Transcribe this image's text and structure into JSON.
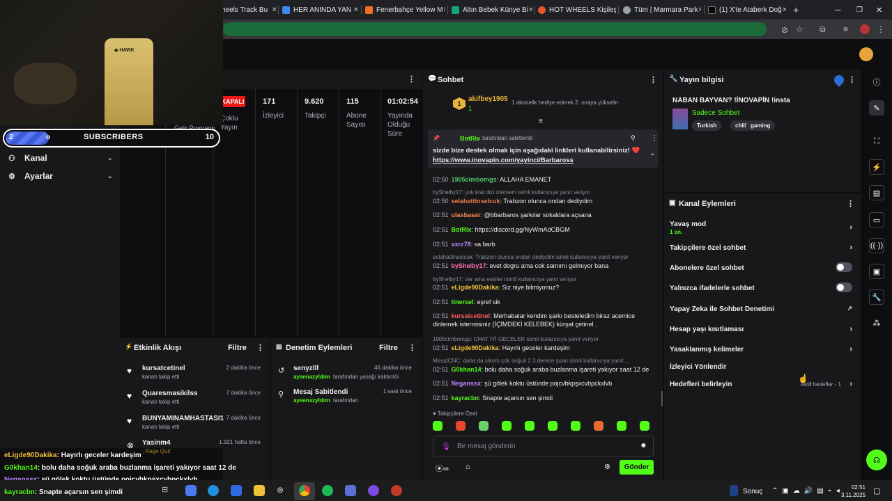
{
  "browser": {
    "tabs": [
      {
        "label": "heels Track Bu"
      },
      {
        "label": "HER ANINDA YAN"
      },
      {
        "label": "Fenerbahçe Yellow M"
      },
      {
        "label": "Altın Bebek Künye Bi"
      },
      {
        "label": "HOT WHEELS Kişileşt"
      },
      {
        "label": "Tüm | Marmara Park"
      },
      {
        "label": "(1) X'te Ataberk Doğ"
      }
    ],
    "new_tab": "+"
  },
  "subs_bar": {
    "left_num": "2",
    "label": "SUBSCRIBERS",
    "right_num": "10",
    "behind_left": "o",
    "behind_right": "Gelir Programı"
  },
  "sidebar": {
    "items": [
      {
        "label": "Kanal"
      },
      {
        "label": "Ayarlar"
      }
    ]
  },
  "stats": {
    "badge": "KAPALI",
    "behind": "Çoklu Yayın",
    "items": [
      {
        "value": "171",
        "label": "İzleyici"
      },
      {
        "value": "9.620",
        "label": "Takipçi"
      },
      {
        "value": "115",
        "label": "Abone Sayısı"
      },
      {
        "value": "01:02:54",
        "label": "Yayında Olduğu Süre"
      }
    ]
  },
  "activity": {
    "title": "Etkinlik Akışı",
    "filter": "Filtre",
    "items": [
      {
        "name": "kursatcetinel",
        "sub": "kanalı takip etti",
        "time": "2 dakika önce"
      },
      {
        "name": "Quaresmasikilss",
        "sub": "kanalı takip etti",
        "time": "7 dakika önce"
      },
      {
        "name": "BUNYAMINAMHASTASI1",
        "sub": "kanalı takip etti",
        "time": "7 dakika önce"
      },
      {
        "name": "Yasinm4",
        "sub": ", Rage Quit",
        "time": "1.921 hafta önce"
      }
    ]
  },
  "moderation": {
    "title": "Denetim Eylemleri",
    "filter": "Filtre",
    "items": [
      {
        "name": "senyzlll",
        "by": "aysenazyldrm",
        "action": "tarafından yasağı kaldırıldı",
        "time": "46 dakika önce"
      },
      {
        "name": "Mesaj Sabitlendi",
        "by": "aysenazyldrm",
        "action": "tarafından",
        "time": "1 saat önce"
      }
    ]
  },
  "chat": {
    "title": "Sohbet",
    "gift": {
      "user": "akifbey1905",
      "count": "1",
      "text": "1 abonelik hediye ederek 2. sıraya yükselin"
    },
    "pinned": {
      "by": "BotRix",
      "by_suffix": "tarafından sabitlendi",
      "text": "sizde bize destek olmak için aşağıdaki linkleri kullanabilirsiniz! ❤️ ;",
      "link": "https://www.inovapin.com/yayinci/Barbaross"
    },
    "messages": [
      {
        "time": "02:50",
        "user": "1905cimbomgs",
        "text": ": ALLAHA EMANET",
        "color": "#4fc46a"
      },
      {
        "reply": "byShelby17: yok kral dizi izlemem isimli kullanıcıya yanıt veriyor"
      },
      {
        "time": "02:50",
        "user": "selahattinselcuk",
        "text": ": Trabzon olunca ondan dediydim",
        "color": "#e87b4c"
      },
      {
        "time": "02:51",
        "user": "ulasbasar",
        "text": ": @bbarbaros şarkılar sokaklara açsana",
        "color": "#f58b4c"
      },
      {
        "time": "02:51",
        "user": "BotRix",
        "text": ": https://discord.gg/NyWmAdCBGM",
        "color": "#53fc18"
      },
      {
        "time": "02:51",
        "user": "vxrz78",
        "text": ": sa barb",
        "color": "#b98cff"
      },
      {
        "reply": "selahattinselcuk: Trabzon olunca ondan dediydim isimli kullanıcıya yanıt veriyor"
      },
      {
        "time": "02:51",
        "user": "byShelby17",
        "text": ": evet dogru ama cok samımı gelmıyor bana",
        "color": "#ff6fb0"
      },
      {
        "reply": "byShelby17: var ama eskiler isimli kullanıcıya yanıt veriyor"
      },
      {
        "time": "02:51",
        "user": "eLigde90Dakika",
        "text": ": Siz niye bilmiyonuz?",
        "color": "#f5c33b"
      },
      {
        "time": "02:51",
        "user": "tinersel",
        "text": ": eşref sik",
        "color": "#53fc18"
      },
      {
        "time": "02:51",
        "user": "kursatcetinel",
        "text": ": Merhabalar kendim şarkı besteledim biraz acemice dinlemek istermisiniz (İÇİMDEKİ KELEBEK) kürşat çetinel .",
        "color": "#ff5c5c"
      },
      {
        "reply": "1905cimbomgs: CHAT İYİ GECELER isimli kullanıcıya yanıt veriyor"
      },
      {
        "time": "02:51",
        "user": "eLigde90Dakika",
        "text": ": Hayırlı geceler kardeşim",
        "color": "#f5c33b"
      },
      {
        "reply": "MesutCNC: daha da sıkıntı çok soğuk 2 3 derece şuan isimli kullanıcıya yanıt ..."
      },
      {
        "time": "02:51",
        "user": "G0khan14",
        "text": ": bolu daha soğuk araba buzlanma işareti yakıyor saat 12 de",
        "color": "#53fc18"
      },
      {
        "time": "02:51",
        "user": "Neganssx",
        "text": ": şü gölek koktu üstünde pojcvbkpşxcvbpckxlvb",
        "color": "#c083ff"
      },
      {
        "time": "02:51",
        "user": "kayracbn",
        "text": ": Snapte açarsın sen şimdi",
        "color": "#53fc18"
      }
    ],
    "followers_only": "Takipçilere Özel",
    "input_placeholder": "Bir mesaj gönderin",
    "send": "Gönder"
  },
  "stream_info": {
    "title": "Yayın bilgisi",
    "stream_title": "NABAN BAYVAN? !İNOVAPİN !insta",
    "category": "Sadece Sohbet",
    "tags": [
      "Turkish",
      "chill",
      "gaming"
    ]
  },
  "channel_actions": {
    "title": "Kanal Eylemleri",
    "slow_mode": "Yavaş mod",
    "slow_value": "1 sn.",
    "rows": [
      {
        "label": "Takipçilere özel sohbet"
      },
      {
        "label": "Abonelere özel sohbet"
      },
      {
        "label": "Yalnızca ifadelerle sohbet"
      },
      {
        "label": "Yapay Zeka ile Sohbet Denetimi"
      },
      {
        "label": "Hesap yaşı kısıtlaması"
      },
      {
        "label": "Yasaklanmış kelimeler"
      },
      {
        "label": "İzleyici Yönlendir"
      },
      {
        "label": "Hedefleri belirleyin"
      }
    ],
    "goals_status": "Aktif hedefler - 1"
  },
  "overlay_chat": [
    {
      "user": "eLigde90Dakika",
      "text": ": Hayırlı geceler kardeşim",
      "color": "#f5c33b"
    },
    {
      "user": "G0khan14",
      "text": ": bolu daha soğuk araba buzlanma işareti yakıyor saat 12 de",
      "color": "#53fc18"
    },
    {
      "user": "Neganssx",
      "text": ": şü gölek koktu üstünde pojcvbkpşxcvbpckxlvb",
      "color": "#c083ff"
    },
    {
      "user": "kayracbn",
      "text": ": Snapte açarsın sen şimdi",
      "color": "#53fc18"
    }
  ],
  "taskbar": {
    "score": "Sonuç",
    "time": "02:51",
    "date": "3.11.2025"
  },
  "colors": {
    "accent": "#53fc18",
    "bg": "#0e0e10",
    "panel": "#18181b",
    "live_badge": "#e91916"
  }
}
